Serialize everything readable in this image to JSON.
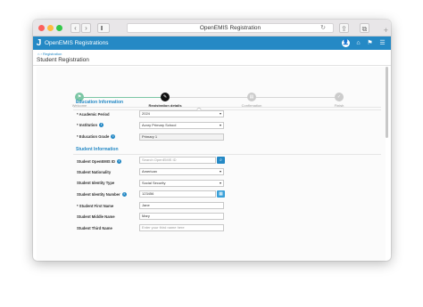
{
  "browser": {
    "url_title": "OpenEMIS Registration",
    "back_icon": "‹",
    "forward_icon": "›",
    "reload_icon": "↻",
    "share_icon": "⇪",
    "tabs_icon": "⧉",
    "new_tab_icon": "+"
  },
  "app": {
    "title": "OpenEMIS Registrations",
    "logo_glyph": "J"
  },
  "header_icons": [
    "👤",
    "⌂",
    "⚑",
    "☰"
  ],
  "breadcrumb": "⌂ › Registration",
  "page_title": "Student Registration",
  "wizard": {
    "steps": [
      {
        "label": "Welcome",
        "glyph": "⚑",
        "state": "done"
      },
      {
        "label": "Registration details",
        "glyph": "✎",
        "state": "active"
      },
      {
        "label": "Confirmation",
        "glyph": "▤",
        "state": "pending"
      },
      {
        "label": "Finish",
        "glyph": "✓",
        "state": "pending"
      }
    ],
    "colors": {
      "done": "#7bc6a4",
      "active": "#111111",
      "pending": "#cccccc"
    }
  },
  "education": {
    "heading": "Education Information",
    "fields": [
      {
        "label": "* Academic Period",
        "value": "2024",
        "dropdown": true
      },
      {
        "label": "* Institution",
        "value": "Avory Primary School",
        "dropdown": true,
        "info": true
      },
      {
        "label": "* Education Grade",
        "value": "Primary 1",
        "dropdown": false,
        "info": true
      }
    ]
  },
  "student": {
    "heading": "Student Information",
    "fields": [
      {
        "label": "Student OpenEMIS ID",
        "value": "Search OpenEMIS ID",
        "placeholder": true,
        "info": true,
        "button": "search"
      },
      {
        "label": "Student Nationality",
        "value": "American",
        "dropdown": true
      },
      {
        "label": "Student Identity Type",
        "value": "Social Security",
        "dropdown": true
      },
      {
        "label": "Student Identity Number",
        "value": "123456",
        "info": true,
        "button": "calendar"
      },
      {
        "label": "* Student First Name",
        "value": "Jane"
      },
      {
        "label": "Student Middle Name",
        "value": "Mary"
      },
      {
        "label": "Student Third Name",
        "value": "Enter your third name here",
        "placeholder": true
      }
    ]
  },
  "icons": {
    "info": "i",
    "dropdown": "▾",
    "search": "⌕",
    "calendar": "▦"
  },
  "accent": "#2589c5"
}
